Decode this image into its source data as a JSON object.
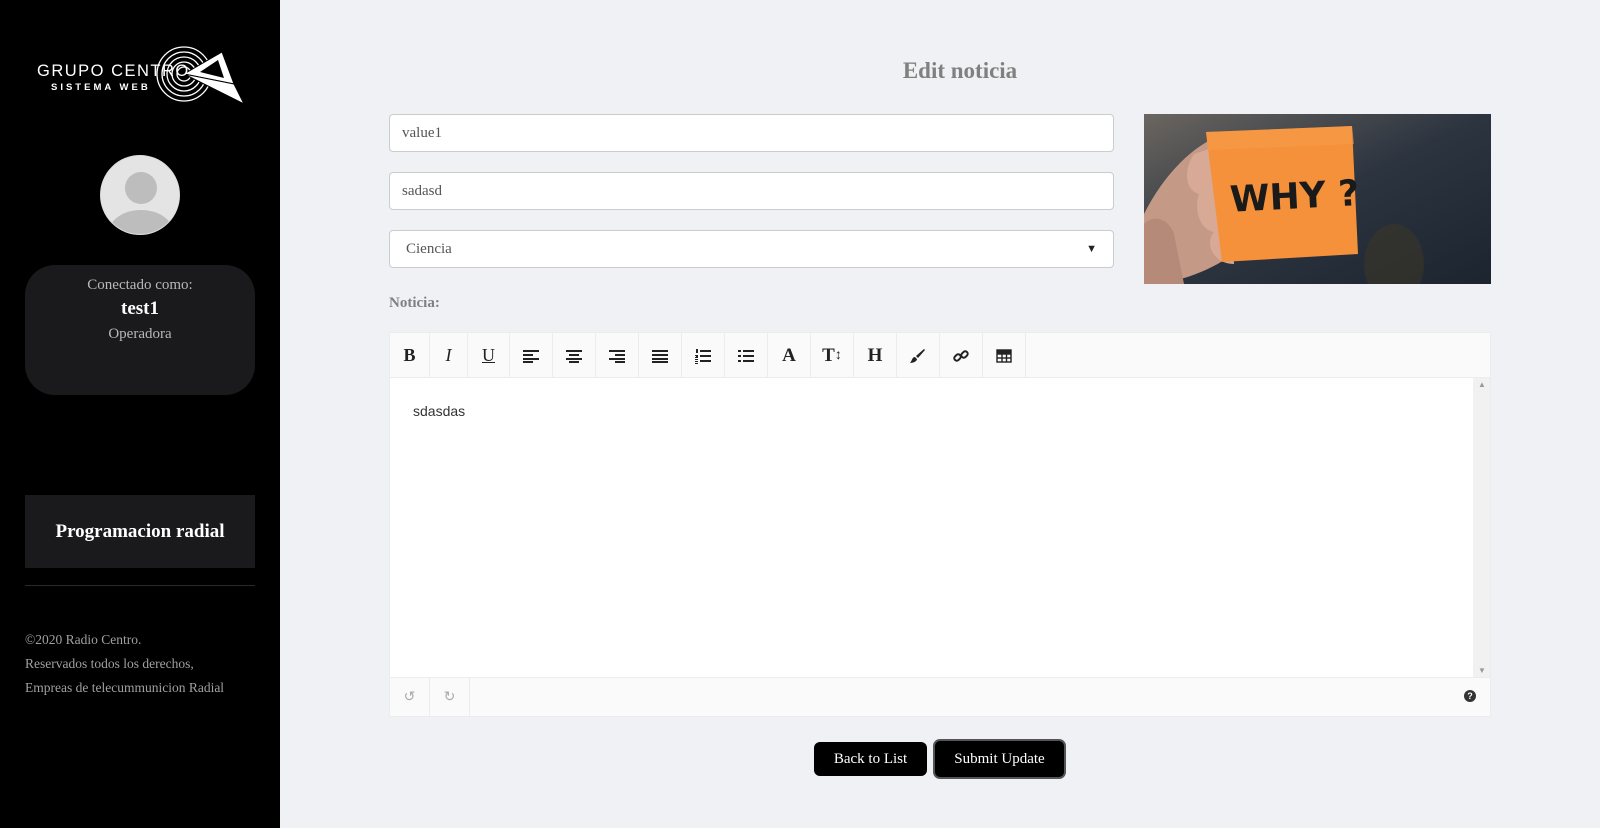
{
  "logo": {
    "line1": "GRUPO CENTRO",
    "line2": "SISTEMA WEB"
  },
  "user": {
    "label": "Conectado como:",
    "name": "test1",
    "role": "Operadora"
  },
  "nav": {
    "programacion": "Programacion radial"
  },
  "footer": {
    "line1": "©2020 Radio Centro.",
    "line2": "Reservados todos los derechos,",
    "line3": "Empreas de telecummunicion Radial"
  },
  "page": {
    "title": "Edit noticia"
  },
  "form": {
    "field1_value": "value1",
    "field2_value": "sadasd",
    "category_selected": "Ciencia",
    "noticia_label": "Noticia:",
    "image_text": "WHY ?"
  },
  "editor": {
    "content": "sdasdas",
    "toolbar": {
      "bold": "B",
      "italic": "I",
      "underline": "U",
      "font": "A",
      "size": "T",
      "heading": "H"
    },
    "icons": [
      "bold-icon",
      "italic-icon",
      "underline-icon",
      "align-left-icon",
      "align-center-icon",
      "align-right-icon",
      "align-justify-icon",
      "ordered-list-icon",
      "unordered-list-icon",
      "font-icon",
      "font-size-icon",
      "heading-icon",
      "brush-icon",
      "link-icon",
      "table-icon",
      "undo-icon",
      "redo-icon",
      "help-icon"
    ]
  },
  "buttons": {
    "back": "Back to List",
    "submit": "Submit Update"
  }
}
